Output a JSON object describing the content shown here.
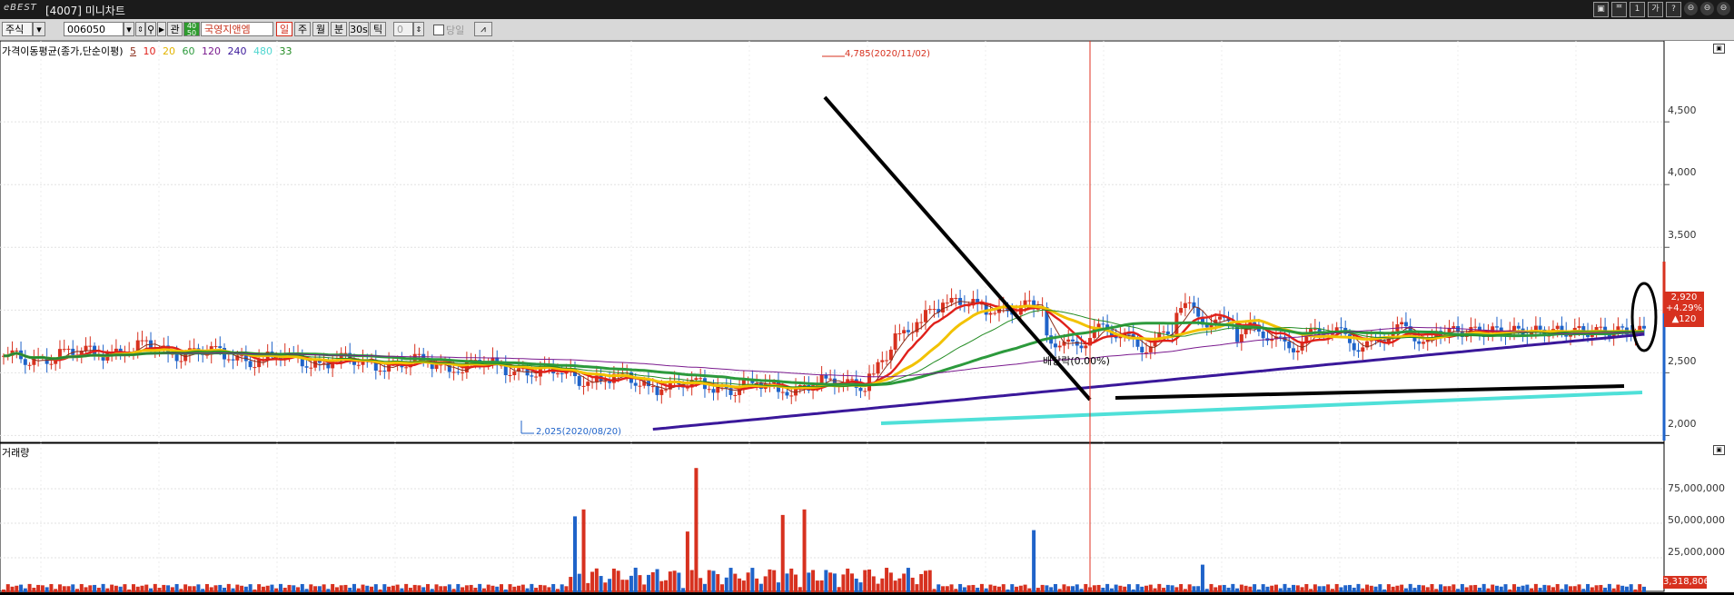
{
  "window": {
    "brand": "eBEST",
    "title": "[4007] 미니차트",
    "buttons": [
      "▣",
      "ᄑ",
      "1",
      "가",
      "?",
      "⊖",
      "⊖",
      "⊖"
    ]
  },
  "toolbar": {
    "market_type": "주식",
    "stock_code": "006050",
    "list_label": "관",
    "grn_top": "40",
    "grn_bottom": "50",
    "stock_name": "국영지앤엠",
    "periods": [
      "일",
      "주",
      "월",
      "분",
      "30s",
      "틱"
    ],
    "active_period": "일",
    "interval_value": "0",
    "same_day_label": "당일"
  },
  "chart_data": {
    "type": "candlestick",
    "title": "가격이동평균(종가,단순이평)",
    "ma_periods": [
      {
        "period": "5",
        "color": "#8b2d1a"
      },
      {
        "period": "10",
        "color": "#e0201a"
      },
      {
        "period": "20",
        "color": "#f2c200"
      },
      {
        "period": "60",
        "color": "#2c9a3c"
      },
      {
        "period": "120",
        "color": "#7a1a8e"
      },
      {
        "period": "240",
        "color": "#3a189a"
      },
      {
        "period": "480",
        "color": "#4fe0d8"
      },
      {
        "period": "33",
        "color": "#228b22"
      }
    ],
    "price_axis": {
      "ticks": [
        "4,500",
        "4,000",
        "3,500",
        "2,500",
        "2,000"
      ],
      "ylim": [
        1880,
        4950
      ]
    },
    "price_high": {
      "label": "4,785(2020/11/02)",
      "value": 4785
    },
    "price_low": {
      "label": "2,025(2020/08/20)",
      "value": 2025
    },
    "ex_right_label": "배당락(0.00%)",
    "current_price": {
      "price": "2,920",
      "change_pct": "+4.29%",
      "change": "▲120"
    },
    "volume_label": "거래량",
    "volume_axis": {
      "ticks": [
        "75,000,000",
        "50,000,000",
        "25,000,000"
      ],
      "ylim": [
        0,
        100000000
      ]
    },
    "current_volume": "3,318,806",
    "colors": {
      "up": "#d7311f",
      "down": "#1f63c9"
    }
  }
}
